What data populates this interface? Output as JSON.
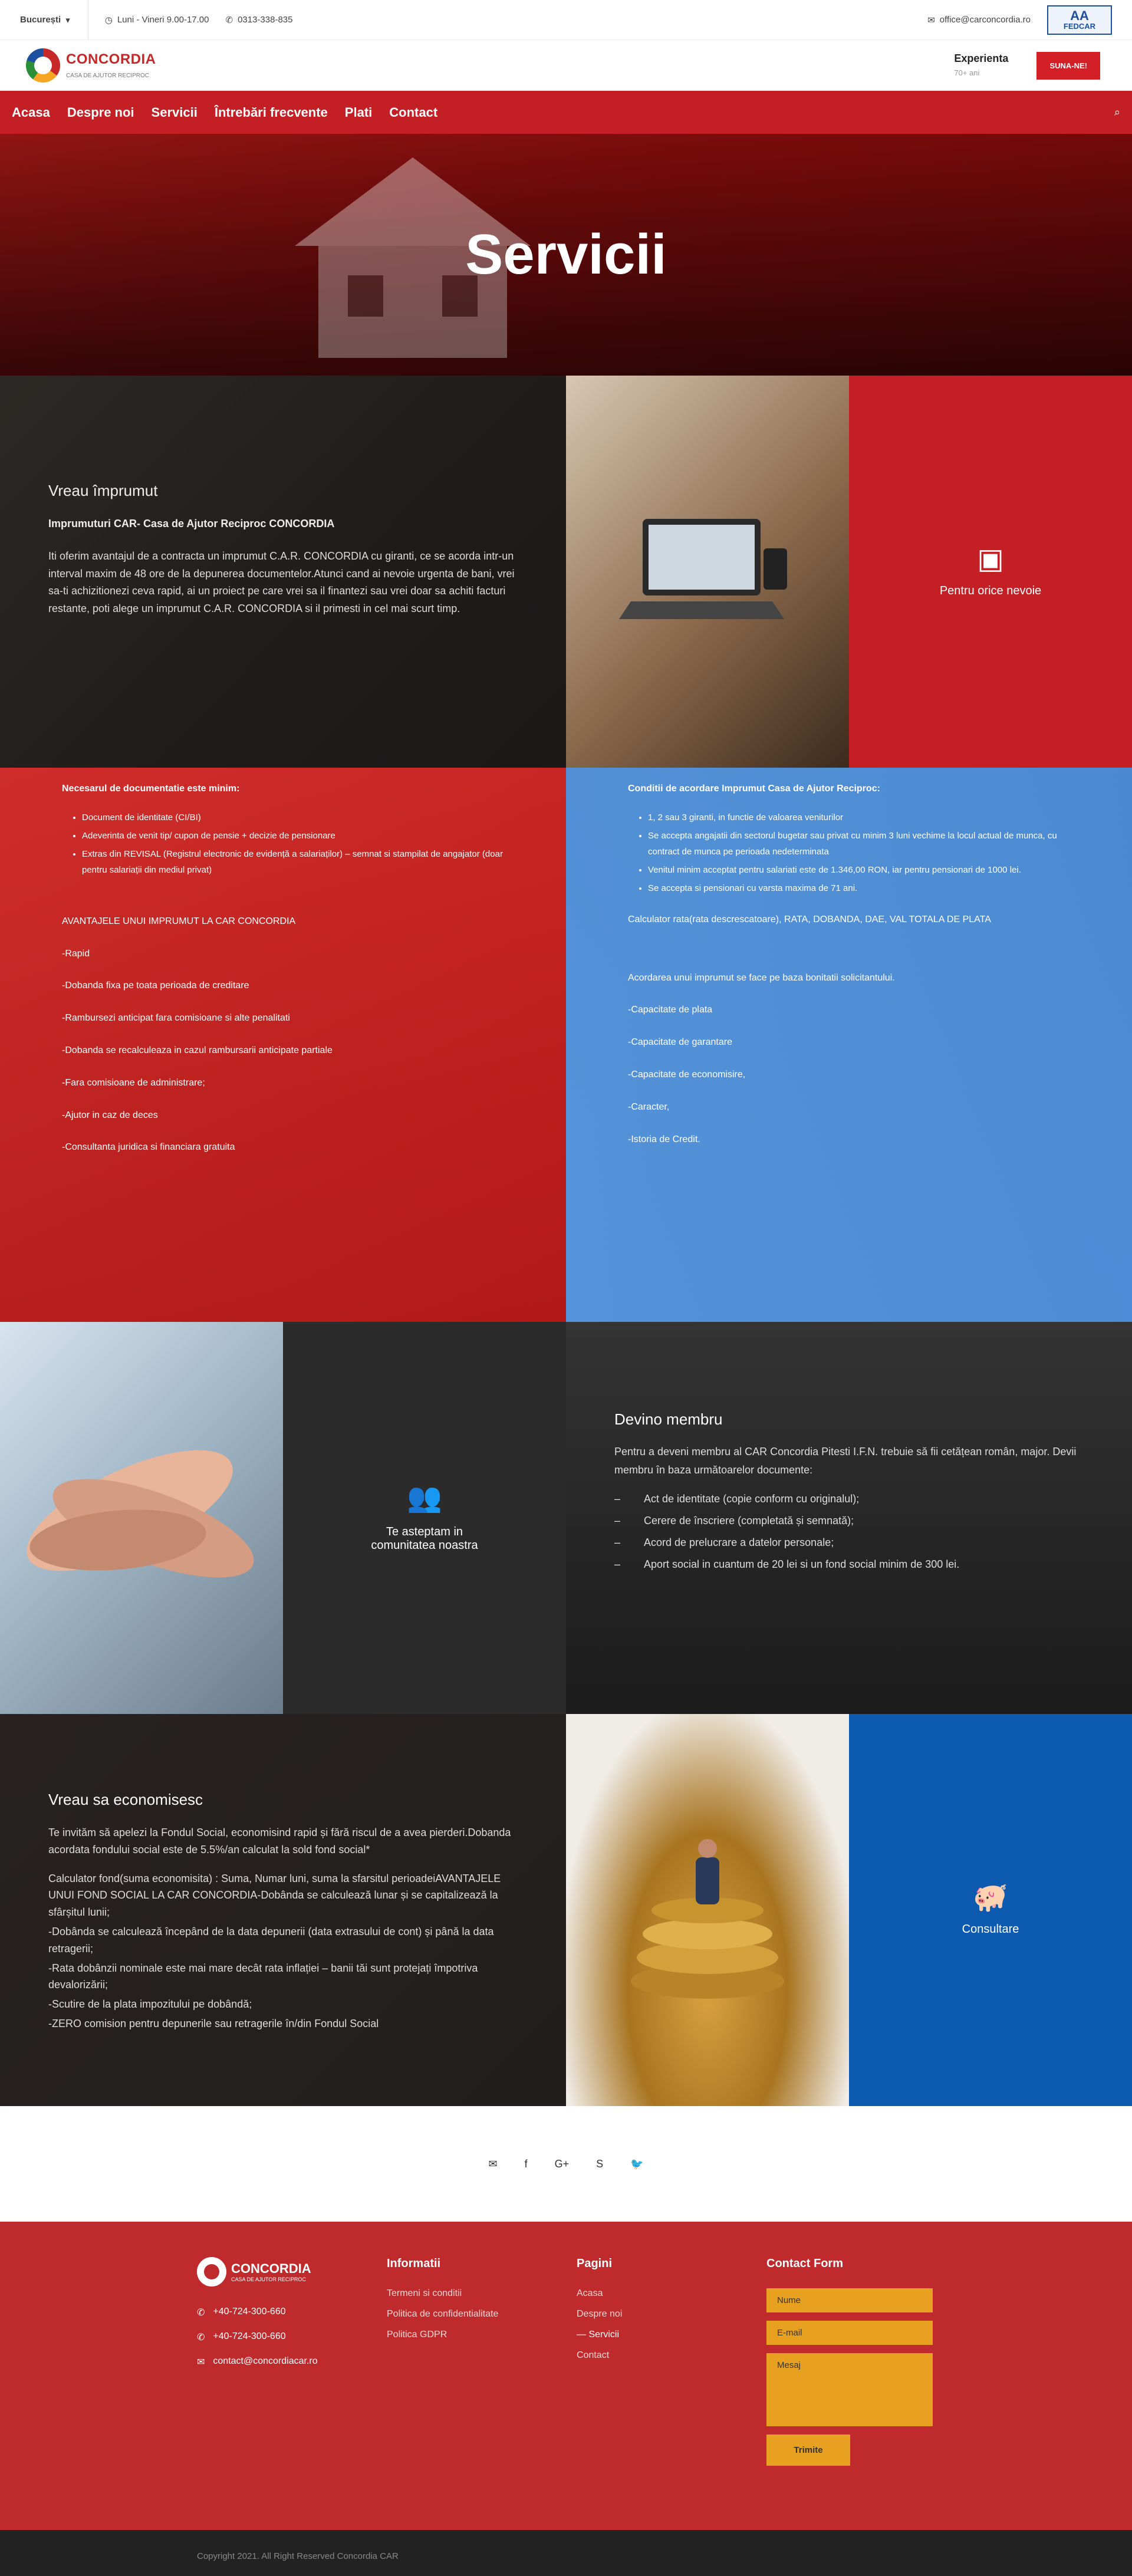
{
  "topbar": {
    "city": "București",
    "hours": "Luni - Vineri 9.00-17.00",
    "phone": "0313-338-835",
    "email": "office@carconcordia.ro",
    "badge_line1": "AA",
    "badge_line2": "FEDCAR"
  },
  "header": {
    "logo_name": "CONCORDIA",
    "logo_tagline": "CASA DE AJUTOR RECIPROC",
    "experience_title": "Experienta",
    "experience_value": "70+ ani",
    "call_button": "SUNA-NE!"
  },
  "nav": {
    "items": [
      "Acasa",
      "Despre noi",
      "Servicii",
      "Întrebări frecvente",
      "Plati",
      "Contact"
    ]
  },
  "hero": {
    "title": "Servicii"
  },
  "loan": {
    "title": "Vreau împrumut",
    "subtitle": "Imprumuturi CAR- Casa de Ajutor Reciproc CONCORDIA",
    "text": "Iti oferim avantajul de a contracta un imprumut C.A.R. CONCORDIA cu giranti, ce se acorda intr-un interval maxim de 48 ore de la depunerea documentelor.Atunci cand ai nevoie urgenta de bani, vrei sa-ti achizitionezi ceva rapid, ai un proiect pe care vrei sa il finantezi sau vrei doar sa achiti facturi restante, poti alege un imprumut C.A.R. CONCORDIA si il primesti in cel mai scurt timp.",
    "box_label": "Pentru orice nevoie"
  },
  "docs": {
    "title": "Necesarul de documentatie este minim:",
    "items": [
      "Document de identitate (CI/BI)",
      "Adeverinta de venit tip/ cupon de pensie + decizie de pensionare",
      "Extras din REVISAL (Registrul electronic de evidență a salariaților) – semnat si stampilat de angajator (doar pentru salariații din mediul privat)"
    ],
    "adv_title": "AVANTAJELE UNUI IMPRUMUT  LA CAR CONCORDIA",
    "advantages": [
      "-Rapid",
      "-Dobanda fixa pe toata perioada de creditare",
      "-Rambursezi anticipat fara comisioane si alte penalitati",
      "-Dobanda se recalculeaza in cazul rambursarii anticipate partiale",
      "-Fara comisioane de administrare;",
      "-Ajutor in caz de deces",
      "-Consultanta juridica si financiara gratuita"
    ]
  },
  "conditions": {
    "title": "Conditii de acordare Imprumut Casa de Ajutor Reciproc:",
    "items": [
      "1, 2 sau 3 giranti, in functie de valoarea veniturilor",
      "Se accepta angajatii din sectorul bugetar sau privat cu minim 3 luni vechime la locul actual de munca, cu contract de munca pe perioada nedeterminata",
      "Venitul minim acceptat pentru salariati este de 1.346,00 RON, iar pentru pensionari de 1000 lei.",
      "Se accepta si pensionari cu varsta maxima de 71 ani."
    ],
    "calculator": "Calculator rata(rata descrescatoare), RATA, DOBANDA, DAE, VAL TOTALA DE PLATA",
    "criteria_intro": "Acordarea unui imprumut se face pe baza bonitatii solicitantului.",
    "criteria": [
      "-Capacitate de plata",
      "-Capacitate de garantare",
      "-Capacitate de economisire,",
      "-Caracter,",
      "-Istoria de Credit."
    ]
  },
  "member": {
    "box_label": "Te asteptam in comunitatea noastra",
    "title": "Devino membru",
    "intro": "Pentru a deveni membru al CAR Concordia Pitesti I.F.N. trebuie să fii cetățean român, major. Devii membru în baza următoarelor documente:",
    "items": [
      "Act de identitate (copie conform cu originalul);",
      "Cerere de înscriere (completată și semnată);",
      "Acord de prelucrare a datelor personale;",
      "Aport social in cuantum de 20 lei si un fond social minim de 300 lei."
    ],
    "dash": "–"
  },
  "savings": {
    "title": "Vreau sa economisesc",
    "p1": "Te invităm să apelezi la Fondul Social, economisind rapid și fără riscul de a avea pierderi.Dobanda acordata fondului social este de 5.5%/an calculat la sold fond social*",
    "p2": "Calculator fond(suma economisita) : Suma, Numar luni, suma la sfarsitul perioadeiAVANTAJELE UNUI FOND SOCIAL LA CAR CONCORDIA-Dobânda se calculează lunar și se capitalizează la sfârșitul lunii;",
    "p3": "-Dobânda se calculează începând de la data depunerii (data extrasului de cont) și până la data retragerii;",
    "p4": "-Rata dobânzii nominale este mai mare decât rata inflației – banii tăi sunt protejați împotriva devalorizării;",
    "p5": "-Scutire de la plata impozitului pe dobândă;",
    "p6": "-ZERO comision pentru depunerile sau retragerile în/din Fondul Social",
    "box_label": "Consultare"
  },
  "social": {
    "icons": [
      "✉",
      "f",
      "G+",
      "S",
      "🐦"
    ]
  },
  "footer": {
    "logo_name": "CONCORDIA",
    "logo_tagline": "CASA DE AJUTOR RECIPROC",
    "phone1": "+40-724-300-660",
    "phone2": "+40-724-300-660",
    "email": "contact@concordiacar.ro",
    "info_title": "Informatii",
    "info_links": [
      "Termeni si conditii",
      "Politica de confidentialitate",
      "Politica GDPR"
    ],
    "pages_title": "Pagini",
    "pages_links": [
      "Acasa",
      "Despre noi",
      "Servicii",
      "Contact"
    ],
    "form_title": "Contact Form",
    "name_placeholder": "Nume",
    "email_placeholder": "E-mail",
    "message_placeholder": "Mesaj",
    "submit": "Trimite",
    "copyright": "Copyright 2021. All Right Reserved Concordia CAR"
  },
  "colors": {
    "brand_red": "#c41f24",
    "brand_blue": "#0d5bb0",
    "form_orange": "#e8a020"
  }
}
